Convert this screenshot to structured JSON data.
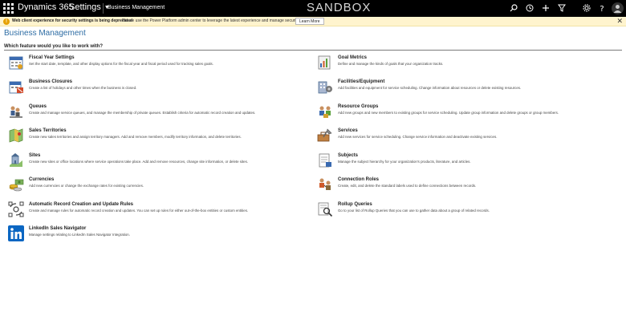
{
  "topbar": {
    "brand": "Dynamics 365",
    "settings_label": "Settings",
    "breadcrumb": "Business Management",
    "environment": "SANDBOX"
  },
  "notification": {
    "bold_text": "Web client experience for security settings is being deprecated",
    "message": "Please use the Power Platform admin center to leverage the latest experience and manage security settings.",
    "learn_more": "Learn More"
  },
  "page": {
    "title": "Business Management",
    "section_label": "Which feature would you like to work with?"
  },
  "left_items": [
    {
      "title": "Fiscal Year Settings",
      "desc": "Set the start date, template, and other display options for the fiscal year and fiscal period used for tracking sales goals.",
      "icon": "calendar-icon"
    },
    {
      "title": "Business Closures",
      "desc": "Create a list of holidays and other times when the business is closed.",
      "icon": "closure-calendar-icon"
    },
    {
      "title": "Queues",
      "desc": "Create and manage service queues, and manage the membership of private queues. Establish criteria for automatic record creation and updates.",
      "icon": "queue-icon"
    },
    {
      "title": "Sales Territories",
      "desc": "Create new sales territories and assign territory managers. Add and remove members, modify territory information, and delete territories.",
      "icon": "territory-map-icon"
    },
    {
      "title": "Sites",
      "desc": "Create new sites or office locations where service operations take place. Add and remove resources, change site information, or delete sites.",
      "icon": "site-icon"
    },
    {
      "title": "Currencies",
      "desc": "Add new currencies or change the exchange rates for existing currencies.",
      "icon": "currency-icon"
    },
    {
      "title": "Automatic Record Creation and Update Rules",
      "desc": "Create and manage rules for automatic record creation and updates. You can set up rules for either out-of-the-box entities or custom entities.",
      "icon": "record-rules-icon"
    },
    {
      "title": "LinkedIn Sales Navigator",
      "desc": "Manage settings relating to LinkedIn Sales Navigator Integration.",
      "icon": "linkedin-icon"
    }
  ],
  "right_items": [
    {
      "title": "Goal Metrics",
      "desc": "Define and manage the kinds of goals that your organization tracks.",
      "icon": "goal-metrics-icon"
    },
    {
      "title": "Facilities/Equipment",
      "desc": "Add facilities and equipment for service scheduling. Change information about resources or delete existing resources.",
      "icon": "facilities-icon"
    },
    {
      "title": "Resource Groups",
      "desc": "Add new groups and new members to existing groups for service scheduling. Update group information and delete groups or group members.",
      "icon": "resource-groups-icon"
    },
    {
      "title": "Services",
      "desc": "Add new services for service scheduling. Change service information and deactivate existing services.",
      "icon": "services-icon"
    },
    {
      "title": "Subjects",
      "desc": "Manage the subject hierarchy for your organization's products, literature, and articles.",
      "icon": "subjects-icon"
    },
    {
      "title": "Connection Roles",
      "desc": "Create, edit, and delete the standard labels used to define connections between records.",
      "icon": "connection-roles-icon"
    },
    {
      "title": "Rollup Queries",
      "desc": "Go to your list of Rollup Queries that you can use to gather data about a group of related records.",
      "icon": "rollup-queries-icon"
    }
  ],
  "colors": {
    "accent": "#2e6da4",
    "topbar": "#000000",
    "notification": "#fff4ce"
  }
}
